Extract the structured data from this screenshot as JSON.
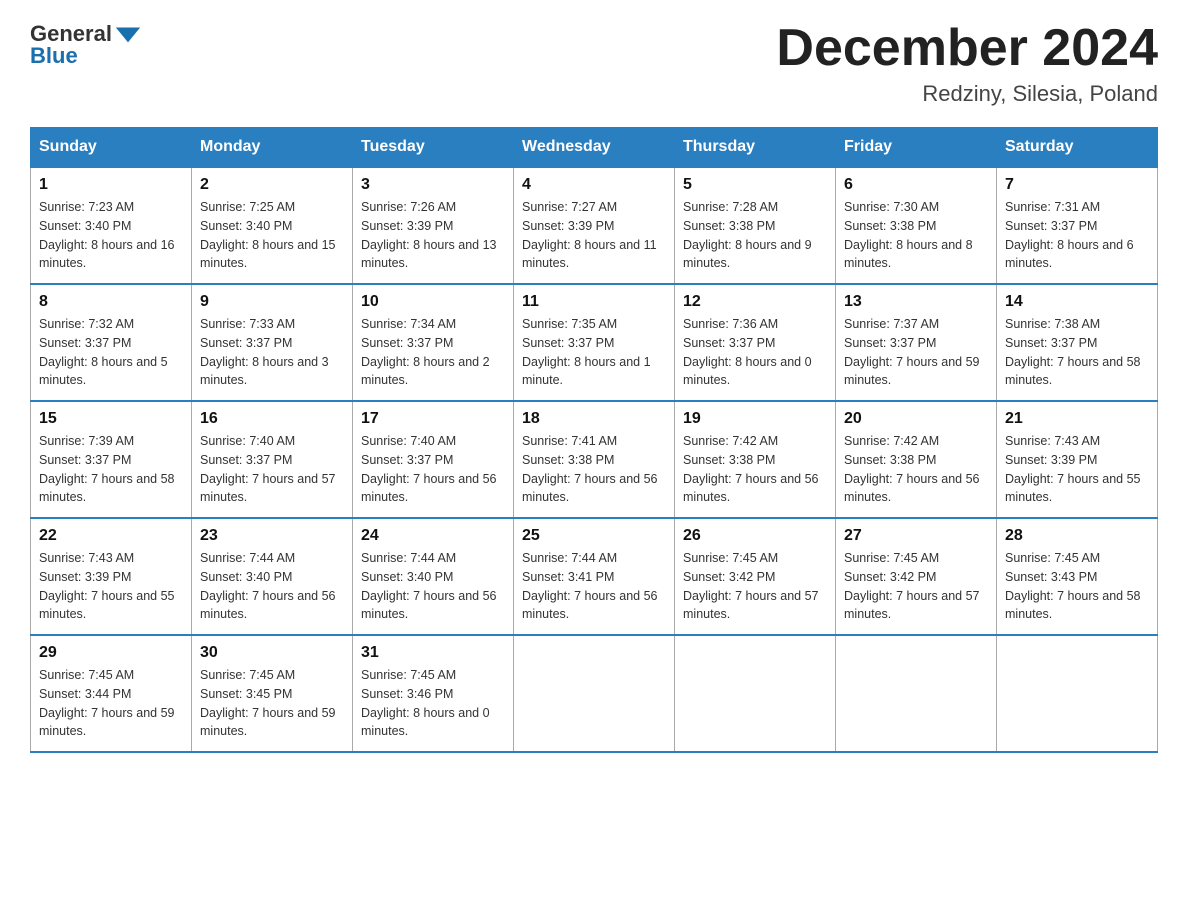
{
  "header": {
    "logo_general": "General",
    "logo_blue": "Blue",
    "month_year": "December 2024",
    "location": "Redziny, Silesia, Poland"
  },
  "days_of_week": [
    "Sunday",
    "Monday",
    "Tuesday",
    "Wednesday",
    "Thursday",
    "Friday",
    "Saturday"
  ],
  "weeks": [
    [
      {
        "day": "1",
        "sunrise": "7:23 AM",
        "sunset": "3:40 PM",
        "daylight": "8 hours and 16 minutes."
      },
      {
        "day": "2",
        "sunrise": "7:25 AM",
        "sunset": "3:40 PM",
        "daylight": "8 hours and 15 minutes."
      },
      {
        "day": "3",
        "sunrise": "7:26 AM",
        "sunset": "3:39 PM",
        "daylight": "8 hours and 13 minutes."
      },
      {
        "day": "4",
        "sunrise": "7:27 AM",
        "sunset": "3:39 PM",
        "daylight": "8 hours and 11 minutes."
      },
      {
        "day": "5",
        "sunrise": "7:28 AM",
        "sunset": "3:38 PM",
        "daylight": "8 hours and 9 minutes."
      },
      {
        "day": "6",
        "sunrise": "7:30 AM",
        "sunset": "3:38 PM",
        "daylight": "8 hours and 8 minutes."
      },
      {
        "day": "7",
        "sunrise": "7:31 AM",
        "sunset": "3:37 PM",
        "daylight": "8 hours and 6 minutes."
      }
    ],
    [
      {
        "day": "8",
        "sunrise": "7:32 AM",
        "sunset": "3:37 PM",
        "daylight": "8 hours and 5 minutes."
      },
      {
        "day": "9",
        "sunrise": "7:33 AM",
        "sunset": "3:37 PM",
        "daylight": "8 hours and 3 minutes."
      },
      {
        "day": "10",
        "sunrise": "7:34 AM",
        "sunset": "3:37 PM",
        "daylight": "8 hours and 2 minutes."
      },
      {
        "day": "11",
        "sunrise": "7:35 AM",
        "sunset": "3:37 PM",
        "daylight": "8 hours and 1 minute."
      },
      {
        "day": "12",
        "sunrise": "7:36 AM",
        "sunset": "3:37 PM",
        "daylight": "8 hours and 0 minutes."
      },
      {
        "day": "13",
        "sunrise": "7:37 AM",
        "sunset": "3:37 PM",
        "daylight": "7 hours and 59 minutes."
      },
      {
        "day": "14",
        "sunrise": "7:38 AM",
        "sunset": "3:37 PM",
        "daylight": "7 hours and 58 minutes."
      }
    ],
    [
      {
        "day": "15",
        "sunrise": "7:39 AM",
        "sunset": "3:37 PM",
        "daylight": "7 hours and 58 minutes."
      },
      {
        "day": "16",
        "sunrise": "7:40 AM",
        "sunset": "3:37 PM",
        "daylight": "7 hours and 57 minutes."
      },
      {
        "day": "17",
        "sunrise": "7:40 AM",
        "sunset": "3:37 PM",
        "daylight": "7 hours and 56 minutes."
      },
      {
        "day": "18",
        "sunrise": "7:41 AM",
        "sunset": "3:38 PM",
        "daylight": "7 hours and 56 minutes."
      },
      {
        "day": "19",
        "sunrise": "7:42 AM",
        "sunset": "3:38 PM",
        "daylight": "7 hours and 56 minutes."
      },
      {
        "day": "20",
        "sunrise": "7:42 AM",
        "sunset": "3:38 PM",
        "daylight": "7 hours and 56 minutes."
      },
      {
        "day": "21",
        "sunrise": "7:43 AM",
        "sunset": "3:39 PM",
        "daylight": "7 hours and 55 minutes."
      }
    ],
    [
      {
        "day": "22",
        "sunrise": "7:43 AM",
        "sunset": "3:39 PM",
        "daylight": "7 hours and 55 minutes."
      },
      {
        "day": "23",
        "sunrise": "7:44 AM",
        "sunset": "3:40 PM",
        "daylight": "7 hours and 56 minutes."
      },
      {
        "day": "24",
        "sunrise": "7:44 AM",
        "sunset": "3:40 PM",
        "daylight": "7 hours and 56 minutes."
      },
      {
        "day": "25",
        "sunrise": "7:44 AM",
        "sunset": "3:41 PM",
        "daylight": "7 hours and 56 minutes."
      },
      {
        "day": "26",
        "sunrise": "7:45 AM",
        "sunset": "3:42 PM",
        "daylight": "7 hours and 57 minutes."
      },
      {
        "day": "27",
        "sunrise": "7:45 AM",
        "sunset": "3:42 PM",
        "daylight": "7 hours and 57 minutes."
      },
      {
        "day": "28",
        "sunrise": "7:45 AM",
        "sunset": "3:43 PM",
        "daylight": "7 hours and 58 minutes."
      }
    ],
    [
      {
        "day": "29",
        "sunrise": "7:45 AM",
        "sunset": "3:44 PM",
        "daylight": "7 hours and 59 minutes."
      },
      {
        "day": "30",
        "sunrise": "7:45 AM",
        "sunset": "3:45 PM",
        "daylight": "7 hours and 59 minutes."
      },
      {
        "day": "31",
        "sunrise": "7:45 AM",
        "sunset": "3:46 PM",
        "daylight": "8 hours and 0 minutes."
      },
      null,
      null,
      null,
      null
    ]
  ],
  "labels": {
    "sunrise_label": "Sunrise:",
    "sunset_label": "Sunset:",
    "daylight_label": "Daylight:"
  }
}
